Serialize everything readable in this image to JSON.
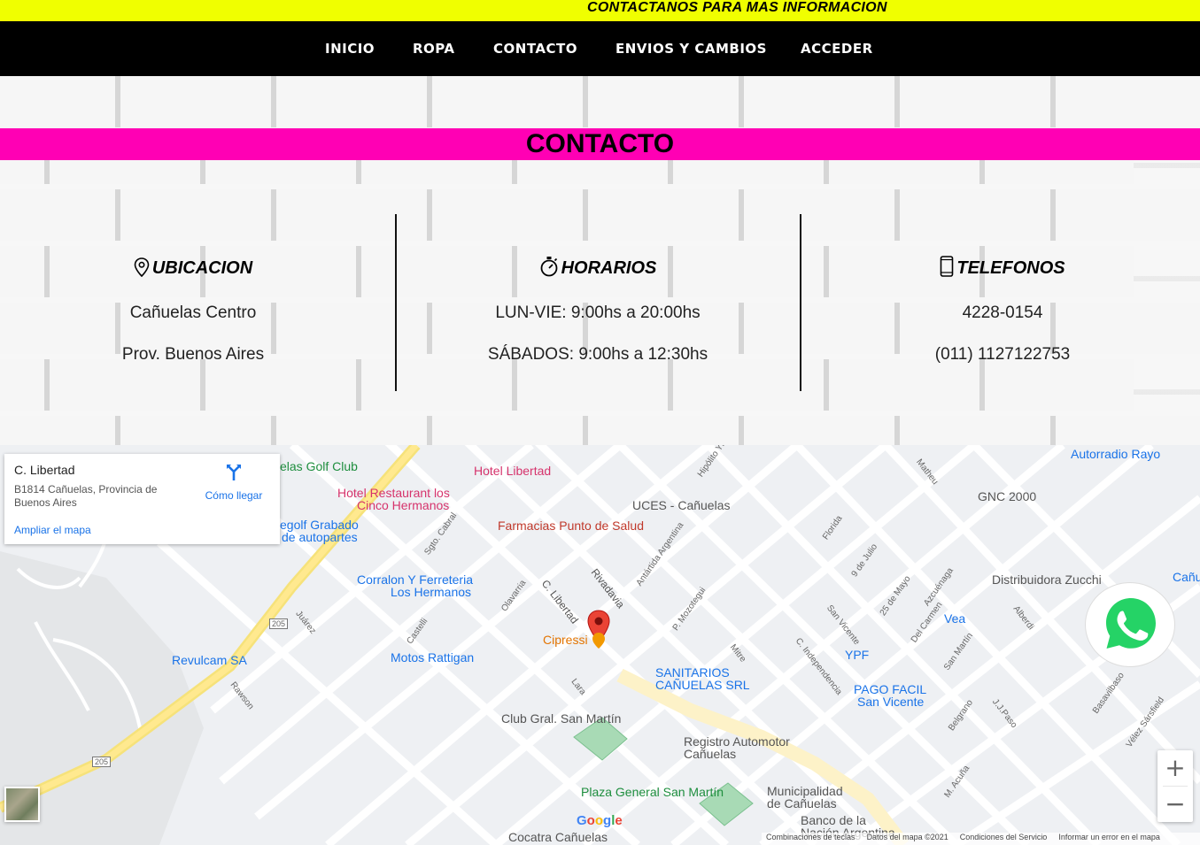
{
  "promo": {
    "text": "CONTACTANOS PARA MAS INFORMACION"
  },
  "nav": {
    "items": [
      "INICIO",
      "ROPA",
      "CONTACTO",
      "ENVIOS Y CAMBIOS",
      "ACCEDER"
    ]
  },
  "page": {
    "title": "CONTACTO"
  },
  "contact": {
    "location": {
      "heading": "UBICACION",
      "line1": "Cañuelas Centro",
      "line2": "Prov. Buenos Aires",
      "icon": "location-pin-icon"
    },
    "hours": {
      "heading": "HORARIOS",
      "line1": "LUN-VIE: 9:00hs a 20:00hs",
      "line2": "SÁBADOS: 9:00hs a 12:30hs",
      "icon": "stopwatch-icon"
    },
    "phones": {
      "heading": "TELEFONOS",
      "line1": "4228-0154",
      "line2": "(011) 1127122753",
      "icon": "mobile-phone-icon"
    }
  },
  "map": {
    "card": {
      "name": "C. Libertad",
      "address": "B1814 Cañuelas, Provincia de Buenos Aires",
      "directions": "Cómo llegar",
      "enlarge": "Ampliar el mapa"
    },
    "places": {
      "golf": "elas Golf Club",
      "hotel_libertad": "Hotel Libertad",
      "hotel_restaurant": "Hotel Restaurant los",
      "hotel_restaurant2": "Cinco Hermanos",
      "grabado": "egolf Grabado",
      "grabado2": "de autopartes",
      "farmacia": "Farmacias Punto de Salud",
      "uces": "UCES - Cañuelas",
      "corralon": "Corralon Y Ferreteria",
      "corralon2": "Los Hermanos",
      "cipressi": "Cipressi",
      "motos": "Motos Rattigan",
      "revulcam": "Revulcam SA",
      "sanitarios": "SANITARIOS",
      "sanitarios2": "CAÑUELAS SRL",
      "club": "Club Gral. San Martín",
      "registro": "Registro Automotor",
      "registro2": "Cañuelas",
      "plaza": "Plaza General San Martín",
      "municipalidad": "Municipalidad",
      "municipalidad2": "de Cañuelas",
      "banco": "Banco de la",
      "banco2": "Nación Argentina",
      "cocatra": "Cocatra Cañuelas",
      "autorradio": "Autorradio Rayo",
      "gnc": "GNC 2000",
      "distribuidora": "Distribuidora Zucchi",
      "canu": "Cañu",
      "vea": "Vea",
      "ypf": "YPF",
      "pago_facil": "PAGO FACIL",
      "pago_facil2": "San Vicente"
    },
    "streets": {
      "libertad": "C. Libertad",
      "rivadavia": "Rivadavia",
      "olavarria": "Olavarria",
      "cabral": "Sgto. Cabral",
      "castelli": "Castelli",
      "lara": "Lara",
      "juarez": "Juárez",
      "rawson": "Rawson",
      "mitre": "Mitre",
      "mozotegui": "P. Mozotegui",
      "antartida": "Antártida Argentina",
      "florida": "Florida",
      "julio": "9 de Julio",
      "mayo": "25 de Mayo",
      "sanvicente": "San Vicente",
      "independencia": "C. Independencia",
      "delcarmen": "Del Carmen",
      "azcuenaga": "Azcuénaga",
      "sanmartin": "San Martín",
      "belgrano": "Belgrano",
      "jjpaso": "J.J.Paso",
      "basavilbaso": "Basavilbaso",
      "velez": "Vélez Sársfield",
      "acuna": "M. Acuña",
      "alberdi": "Alberdi",
      "matheu": "Matheu",
      "hipolito": "Hipólito Yri",
      "route": "205"
    },
    "footer": {
      "shortcuts": "Combinaciones de teclas",
      "data": "Datos del mapa ©2021",
      "terms": "Condiciones del Servicio",
      "report": "Informar un error en el mapa"
    },
    "google": "Google",
    "zoom_in": "+",
    "zoom_out": "−"
  },
  "colors": {
    "promo": "#f0ff00",
    "nav": "#000000",
    "title_band": "#ff00b4",
    "whatsapp": "#25d366"
  }
}
